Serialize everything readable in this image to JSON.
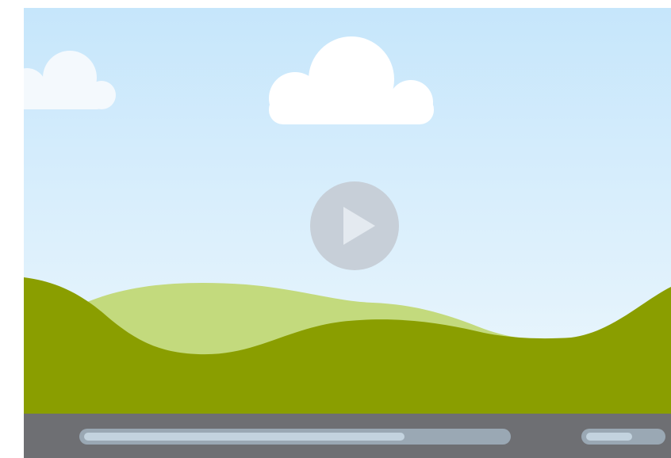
{
  "video": {
    "sky_top_color": "#c6e6fb",
    "sky_bottom_color": "#edf7fd",
    "cloud_color": "#ffffff",
    "far_hill_color": "#c3da7d",
    "near_hill_color": "#8a9e00",
    "play_icon": "play-icon",
    "play_button_color": "#c7cfd8"
  },
  "controls": {
    "bar_color": "#6e6f73",
    "progress_fraction": 0.76,
    "volume_fraction": 0.62
  }
}
